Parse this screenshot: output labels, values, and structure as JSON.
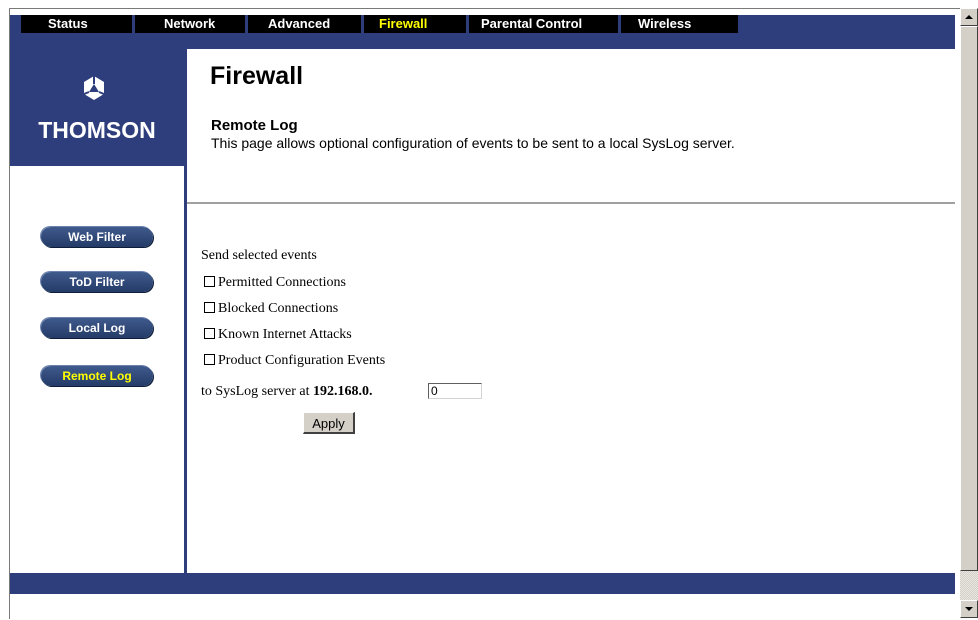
{
  "nav": {
    "items": [
      {
        "label": "Status",
        "active": false
      },
      {
        "label": "Network",
        "active": false
      },
      {
        "label": "Advanced",
        "active": false
      },
      {
        "label": "Firewall",
        "active": true
      },
      {
        "label": "Parental Control",
        "active": false
      },
      {
        "label": "Wireless",
        "active": false
      }
    ]
  },
  "brand": {
    "name": "THOMSON",
    "logo_icon": "thomson-logo-icon"
  },
  "sidebar": {
    "items": [
      {
        "label": "Web Filter",
        "active": false
      },
      {
        "label": "ToD Filter",
        "active": false
      },
      {
        "label": "Local Log",
        "active": false
      },
      {
        "label": "Remote Log",
        "active": true
      }
    ]
  },
  "main": {
    "title": "Firewall",
    "section_title": "Remote Log",
    "section_desc": "This page allows optional configuration of events to be sent to a local SysLog server."
  },
  "form": {
    "intro": "Send selected events",
    "events": [
      {
        "label": "Permitted Connections",
        "checked": false
      },
      {
        "label": "Blocked Connections",
        "checked": false
      },
      {
        "label": "Known Internet Attacks",
        "checked": false
      },
      {
        "label": "Product Configuration Events",
        "checked": false
      }
    ],
    "server_prefix": "to SysLog server at",
    "ip_prefix": "192.168.0.",
    "ip_value": "0",
    "apply_label": "Apply"
  },
  "colors": {
    "brand_blue": "#2e3d7c",
    "active_yellow": "#ffff00",
    "nav_black": "#000000"
  }
}
